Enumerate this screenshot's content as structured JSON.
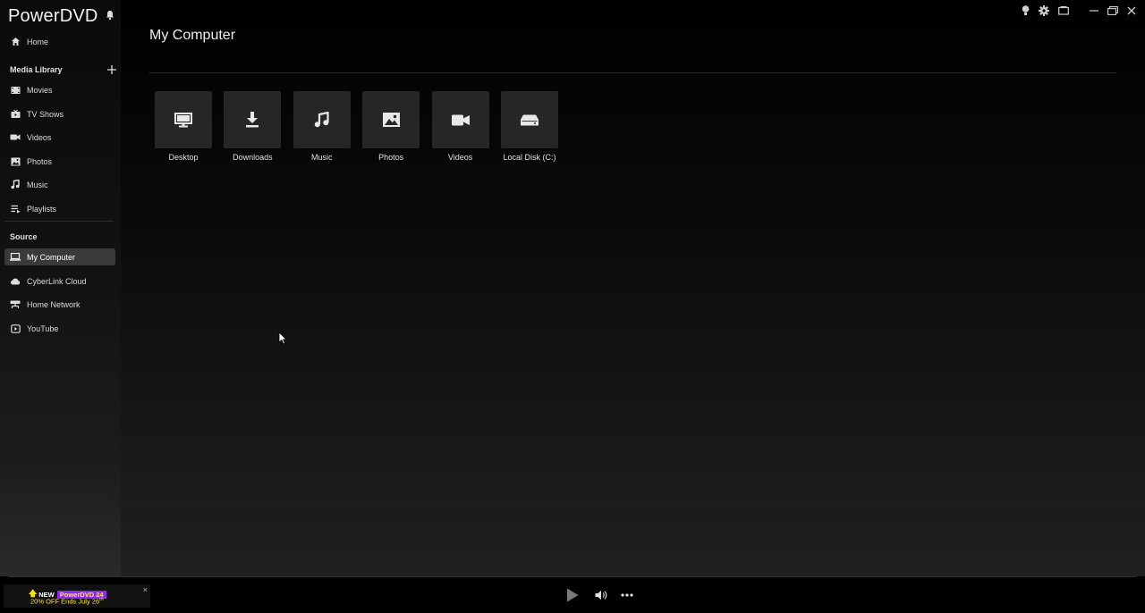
{
  "app": {
    "name": "PowerDVD"
  },
  "sidebar": {
    "home": "Home",
    "media_library": {
      "title": "Media Library",
      "items": [
        {
          "label": "Movies",
          "icon": "film-icon"
        },
        {
          "label": "TV Shows",
          "icon": "tv-icon"
        },
        {
          "label": "Videos",
          "icon": "video-camera-icon"
        },
        {
          "label": "Photos",
          "icon": "image-icon"
        },
        {
          "label": "Music",
          "icon": "music-note-icon"
        },
        {
          "label": "Playlists",
          "icon": "playlist-icon"
        }
      ]
    },
    "source": {
      "title": "Source",
      "items": [
        {
          "label": "My Computer",
          "icon": "laptop-icon",
          "active": true
        },
        {
          "label": "CyberLink Cloud",
          "icon": "cloud-icon"
        },
        {
          "label": "Home Network",
          "icon": "network-icon"
        },
        {
          "label": "YouTube",
          "icon": "youtube-icon"
        }
      ]
    }
  },
  "main": {
    "title": "My Computer",
    "tiles": [
      {
        "label": "Desktop",
        "icon": "monitor-icon"
      },
      {
        "label": "Downloads",
        "icon": "download-icon"
      },
      {
        "label": "Music",
        "icon": "music-note-icon"
      },
      {
        "label": "Photos",
        "icon": "image-icon"
      },
      {
        "label": "Videos",
        "icon": "video-camera-icon"
      },
      {
        "label": "Local Disk (C:)",
        "icon": "hard-drive-icon"
      }
    ]
  },
  "promo": {
    "new": "NEW",
    "product": "PowerDVD 24",
    "offer_main": "20% OFF Ends July 26",
    "offer_sup": "th",
    "close": "×"
  },
  "colors": {
    "background": "#000000",
    "tile_bg": "#262626",
    "active_item_bg": "#3a3a3a",
    "promo_badge": "#8c2cf0",
    "promo_text": "#ffe14a"
  }
}
